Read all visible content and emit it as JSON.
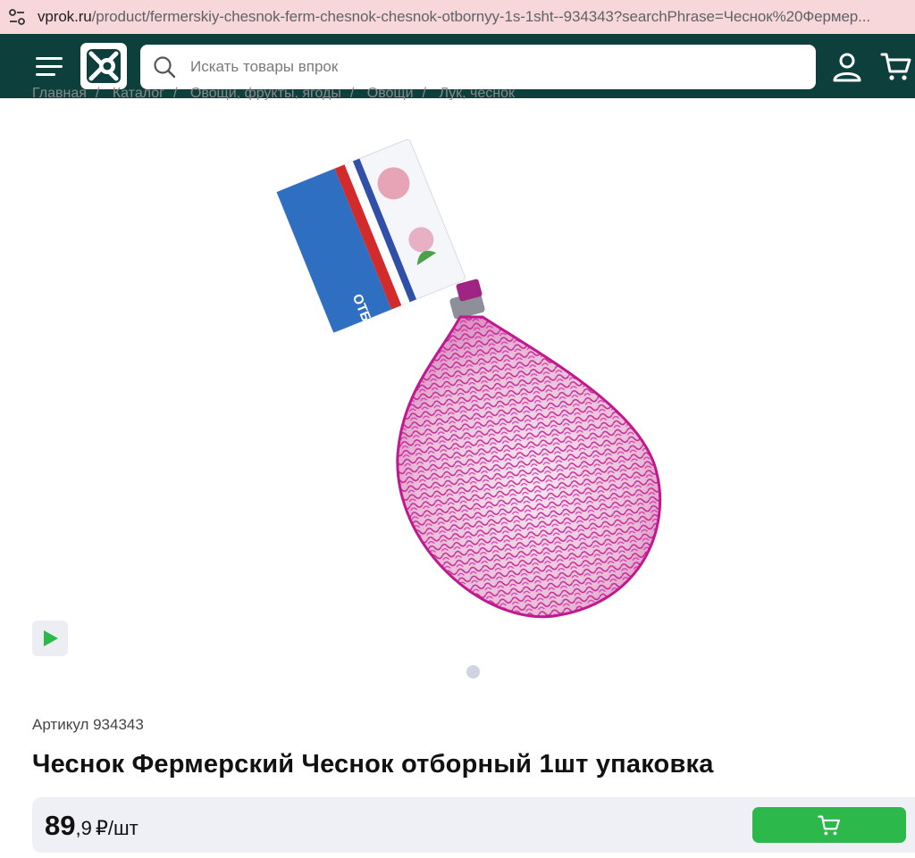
{
  "browser": {
    "url_domain": "vprok.ru",
    "url_path": "/product/fermerskiy-chesnok-ferm-chesnok-chesnok-otbornyy-1s-1sht--934343?searchPhrase=Чеснок%20Фермер..."
  },
  "header": {
    "search_placeholder": "Искать товары впрок"
  },
  "breadcrumb": [
    "Главная",
    "Каталог",
    "Овощи, фрукты, ягоды",
    "Овощи",
    "Лук, чеснок"
  ],
  "product": {
    "article": "Артикул 934343",
    "title": "Чеснок Фермерский Чеснок отборный 1шт упаковка",
    "label_text": "ОТБОРНЫЙ",
    "price_int": "89",
    "price_frac": ",9",
    "price_unit": "₽/шт"
  },
  "colors": {
    "header_bg": "#0d3f3d",
    "accent_green": "#2db84b",
    "urlbar_bg": "#f7d7da"
  }
}
